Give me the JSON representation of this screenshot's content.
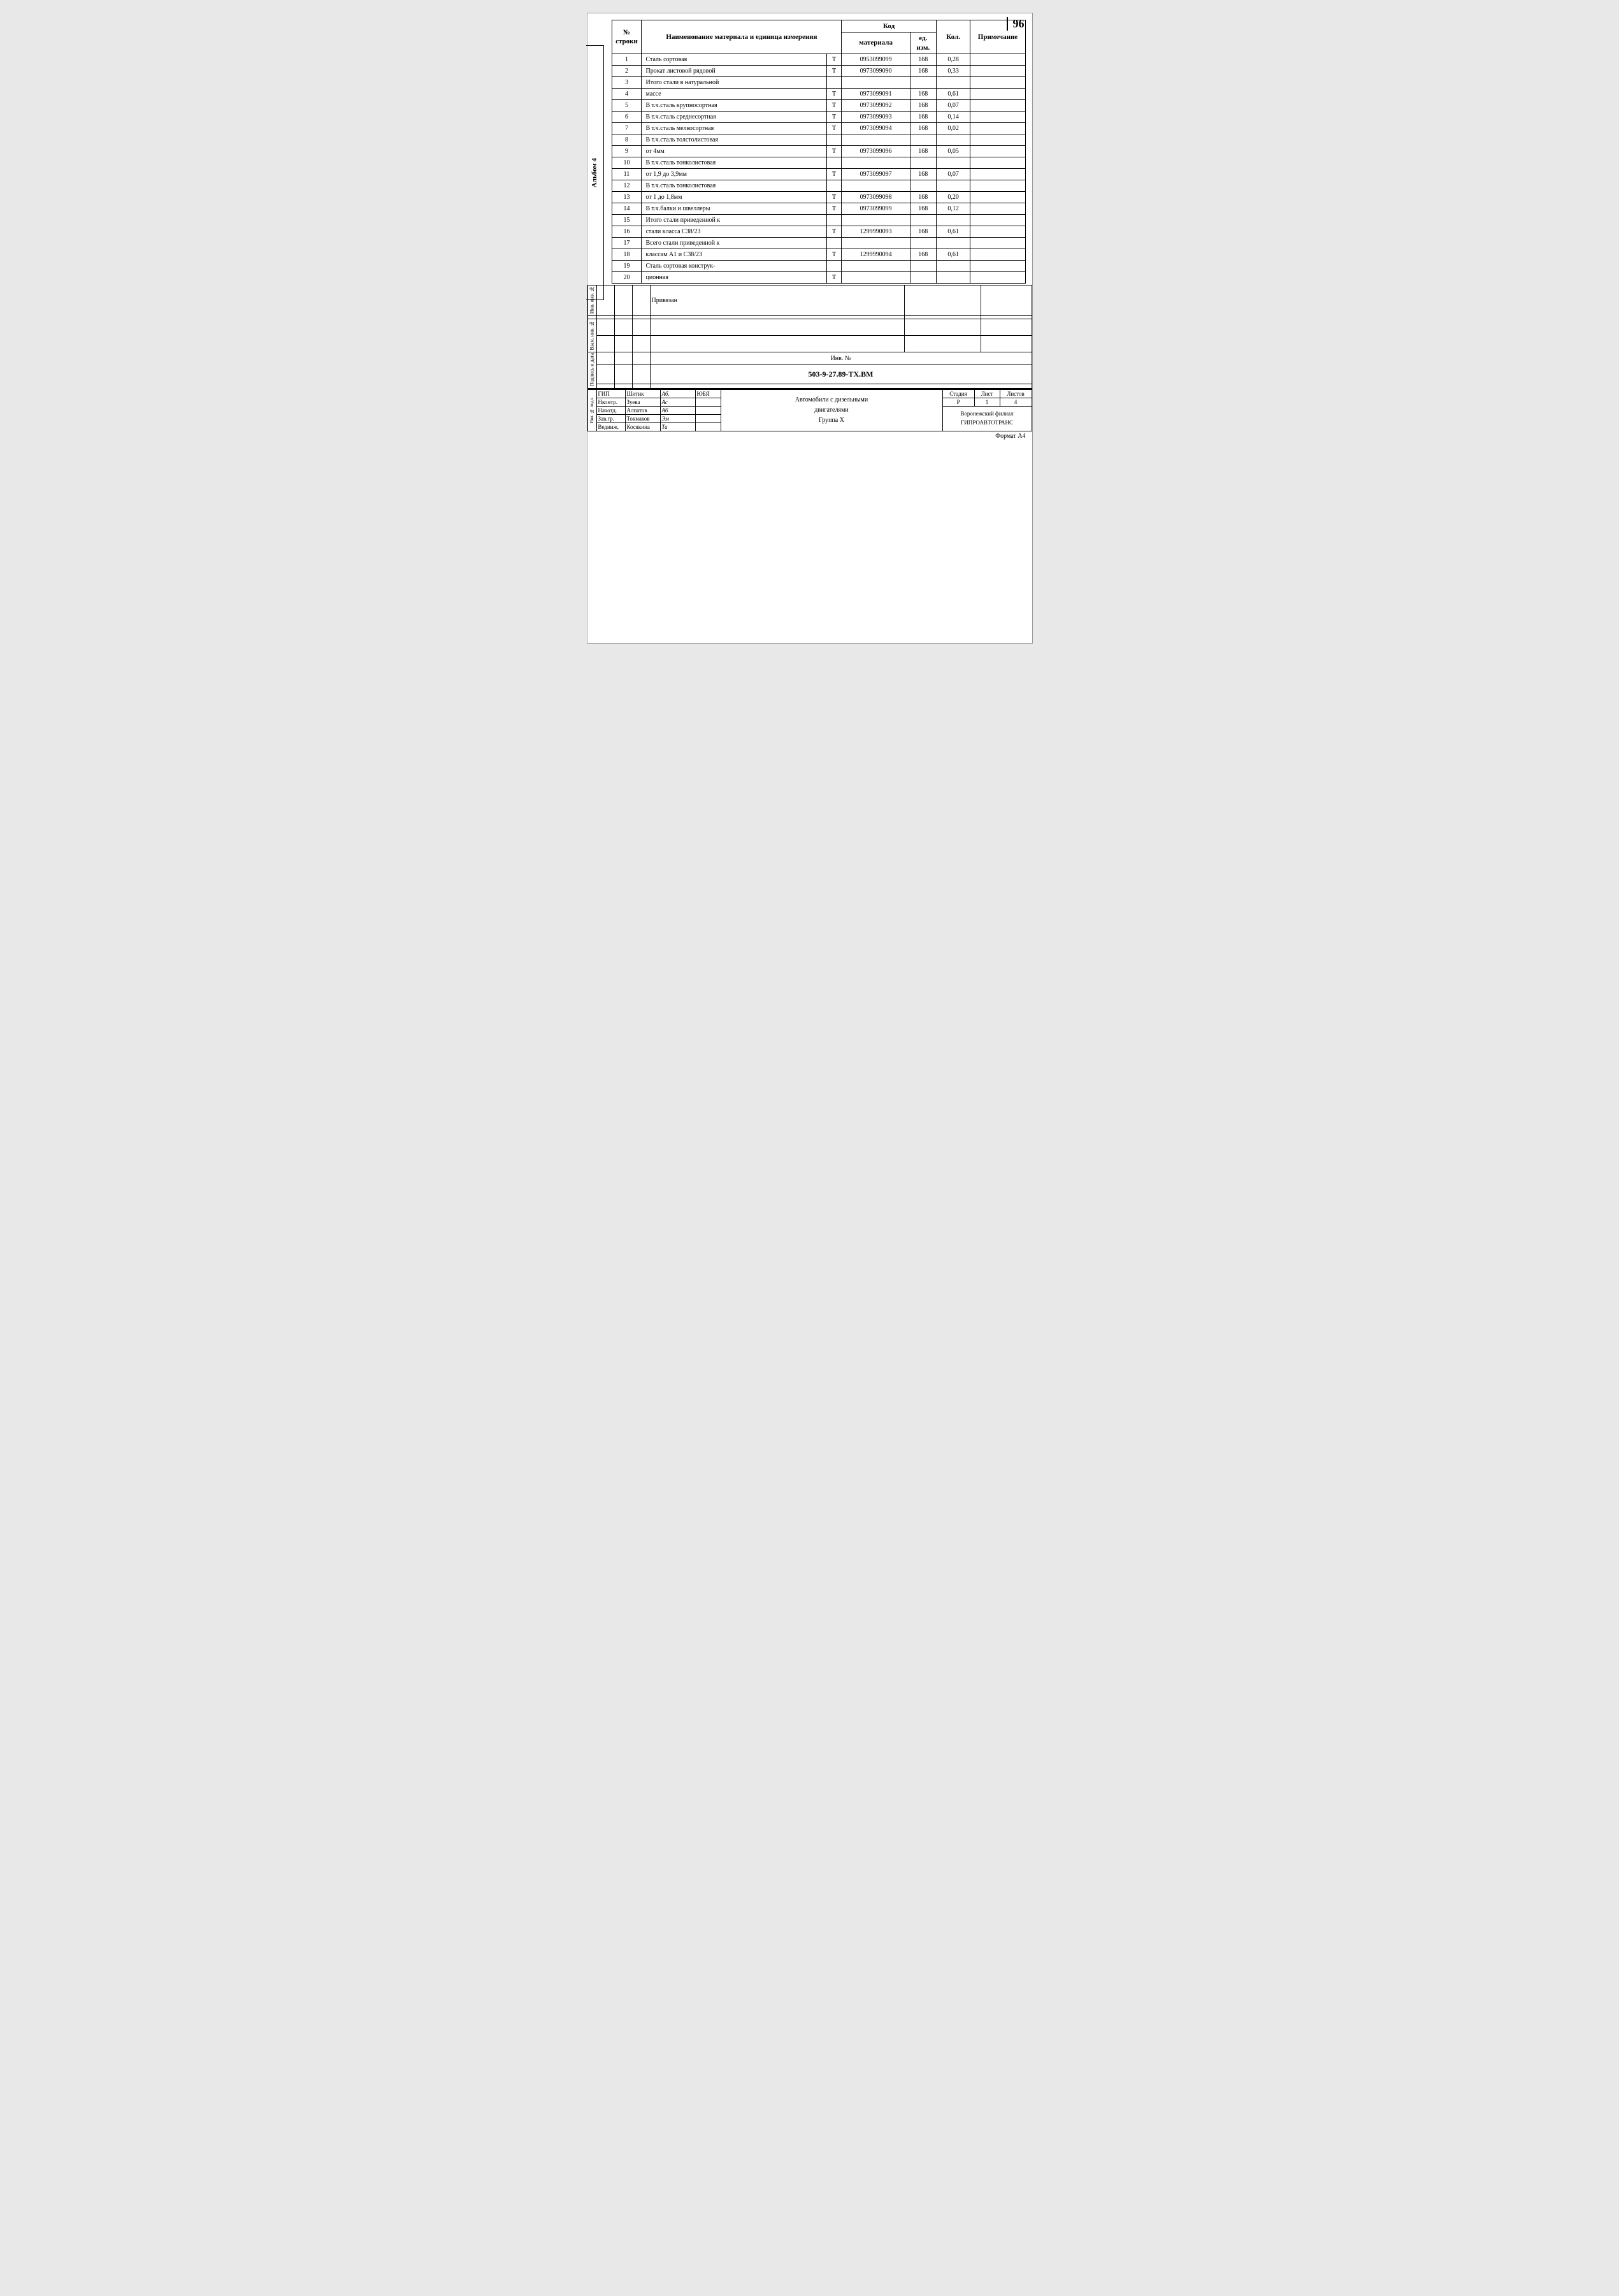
{
  "page": {
    "number": "96",
    "format": "Формат А4"
  },
  "side_label": "Альбом 4",
  "header": {
    "col_name": "Наименование материала и единица измерения",
    "col_kod": "Код",
    "col_material": "материала",
    "col_ed_izm": "ед. изм.",
    "col_kol": "Кол.",
    "col_note": "Примечание"
  },
  "rows": [
    {
      "num": "1",
      "name": "Сталь сортовая",
      "unit": "Т",
      "mat_code": "0953099099",
      "ed_izm": "168",
      "kol": "0,28",
      "note": ""
    },
    {
      "num": "2",
      "name": "Прокат листовой рядовой",
      "unit": "Т",
      "mat_code": "0973099090",
      "ed_izm": "168",
      "kol": "0,33",
      "note": ""
    },
    {
      "num": "3",
      "name": "Итого стали в натуральной",
      "unit": "",
      "mat_code": "",
      "ed_izm": "",
      "kol": "",
      "note": ""
    },
    {
      "num": "4",
      "name": "массе",
      "unit": "Т",
      "mat_code": "0973099091",
      "ed_izm": "168",
      "kol": "0,61",
      "note": ""
    },
    {
      "num": "5",
      "name": "В т.ч.сталь крупносортная",
      "unit": "Т",
      "mat_code": "0973099092",
      "ed_izm": "168",
      "kol": "0,07",
      "note": ""
    },
    {
      "num": "6",
      "name": "В т.ч.сталь среднесортная",
      "unit": "Т",
      "mat_code": "0973099093",
      "ed_izm": "168",
      "kol": "0,14",
      "note": ""
    },
    {
      "num": "7",
      "name": "В т.ч.сталь мелкосортная",
      "unit": "Т",
      "mat_code": "0973099094",
      "ed_izm": "168",
      "kol": "0,02",
      "note": ""
    },
    {
      "num": "8",
      "name": "В т.ч.сталь толстолистовая",
      "unit": "",
      "mat_code": "",
      "ed_izm": "",
      "kol": "",
      "note": ""
    },
    {
      "num": "9",
      "name": "от 4мм",
      "unit": "Т",
      "mat_code": "0973099096",
      "ed_izm": "168",
      "kol": "0,05",
      "note": ""
    },
    {
      "num": "10",
      "name": "В т.ч.сталь тонколистовая",
      "unit": "",
      "mat_code": "",
      "ed_izm": "",
      "kol": "",
      "note": ""
    },
    {
      "num": "11",
      "name": "от 1,9 до 3,9мм",
      "unit": "Т",
      "mat_code": "0973099097",
      "ed_izm": "168",
      "kol": "0,07",
      "note": ""
    },
    {
      "num": "12",
      "name": "В т.ч.сталь тонколистовая",
      "unit": "",
      "mat_code": "",
      "ed_izm": "",
      "kol": "",
      "note": ""
    },
    {
      "num": "13",
      "name": "от 1 до 1,8мм",
      "unit": "Т",
      "mat_code": "0973099098",
      "ed_izm": "168",
      "kol": "0,20",
      "note": ""
    },
    {
      "num": "14",
      "name": "В т.ч.балки и швеллеры",
      "unit": "Т",
      "mat_code": "0973099099",
      "ed_izm": "168",
      "kol": "0,12",
      "note": ""
    },
    {
      "num": "15",
      "name": "Итого стали приведенной к",
      "unit": "",
      "mat_code": "",
      "ed_izm": "",
      "kol": "",
      "note": ""
    },
    {
      "num": "16",
      "name": "стали класса С38/23",
      "unit": "Т",
      "mat_code": "1299990093",
      "ed_izm": "168",
      "kol": "0,61",
      "note": ""
    },
    {
      "num": "17",
      "name": "Всего стали приведенной к",
      "unit": "",
      "mat_code": "",
      "ed_izm": "",
      "kol": "",
      "note": ""
    },
    {
      "num": "18",
      "name": "классам А1 и С38/23",
      "unit": "Т",
      "mat_code": "1299990094",
      "ed_izm": "168",
      "kol": "0,61",
      "note": ""
    },
    {
      "num": "19",
      "name": "Сталь сортовая конструк-",
      "unit": "",
      "mat_code": "",
      "ed_izm": "",
      "kol": "",
      "note": ""
    },
    {
      "num": "20",
      "name": "ционная",
      "unit": "Т",
      "mat_code": "",
      "ed_izm": "",
      "kol": "",
      "note": ""
    }
  ],
  "footer": {
    "privyazan": "Привязан",
    "inv_no_label": "Инв. №",
    "doc_number": "503-9-27.89-ТХ.ВМ",
    "title_line1": "Автомобили с дизельными",
    "title_line2": "двигателями",
    "title_line3": "Группа X",
    "stadiya_label": "Стадия",
    "list_label": "Лист",
    "listov_label": "Листов",
    "stadiya_val": "Р",
    "list_val": "1",
    "listov_val": "4",
    "org": "Воронежский филиал ГИПРОАВТОТРАНС",
    "persons": [
      {
        "role": "ГИП",
        "name": "Шитик",
        "sign": "Аб.",
        "date": "ЮБЯ"
      },
      {
        "role": "Нконтр.",
        "name": "Зуева",
        "sign": "Ас",
        "date": ""
      },
      {
        "role": "Начотд.",
        "name": "Алпатов",
        "sign": "Аб",
        "date": ""
      },
      {
        "role": "Зав.гр.",
        "name": "Токмаков",
        "sign": "Эм",
        "date": ""
      },
      {
        "role": "Вединж.",
        "name": "Косякина",
        "sign": "Та",
        "date": ""
      }
    ],
    "side_labels": {
      "inv_pod": "Инв. № подл.",
      "podpis_data": "Подпись и дата",
      "vzam_inv": "Взам. инв. №",
      "inv_inv": "Инв. инв. №"
    }
  }
}
